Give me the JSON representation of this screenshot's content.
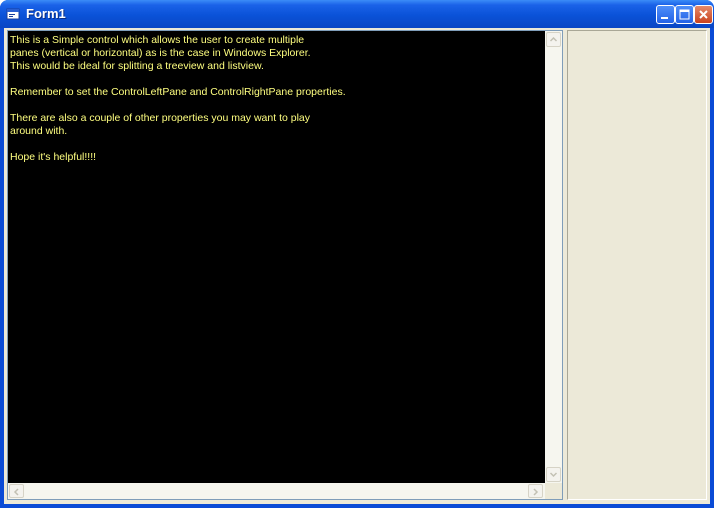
{
  "window": {
    "title": "Form1",
    "icon": "vb-form-icon"
  },
  "title_buttons": {
    "minimize_icon": "minimize-icon",
    "maximize_icon": "maximize-icon",
    "close_icon": "close-icon"
  },
  "textbox": {
    "lines": [
      "This is a Simple control which allows the user to create multiple",
      "panes (vertical or horizontal) as is the case in Windows Explorer.",
      "This would be ideal for splitting a treeview and listview.",
      "",
      "Remember to set the ControlLeftPane and ControlRightPane properties.",
      "",
      "There are also a couple of other properties you may want to play",
      "around with.",
      "",
      "Hope it's helpful!!!!"
    ],
    "background": "#000000",
    "text_color": "#ffff80"
  },
  "colors": {
    "titlebar": "#0a52d8",
    "client": "#ece9d8"
  }
}
